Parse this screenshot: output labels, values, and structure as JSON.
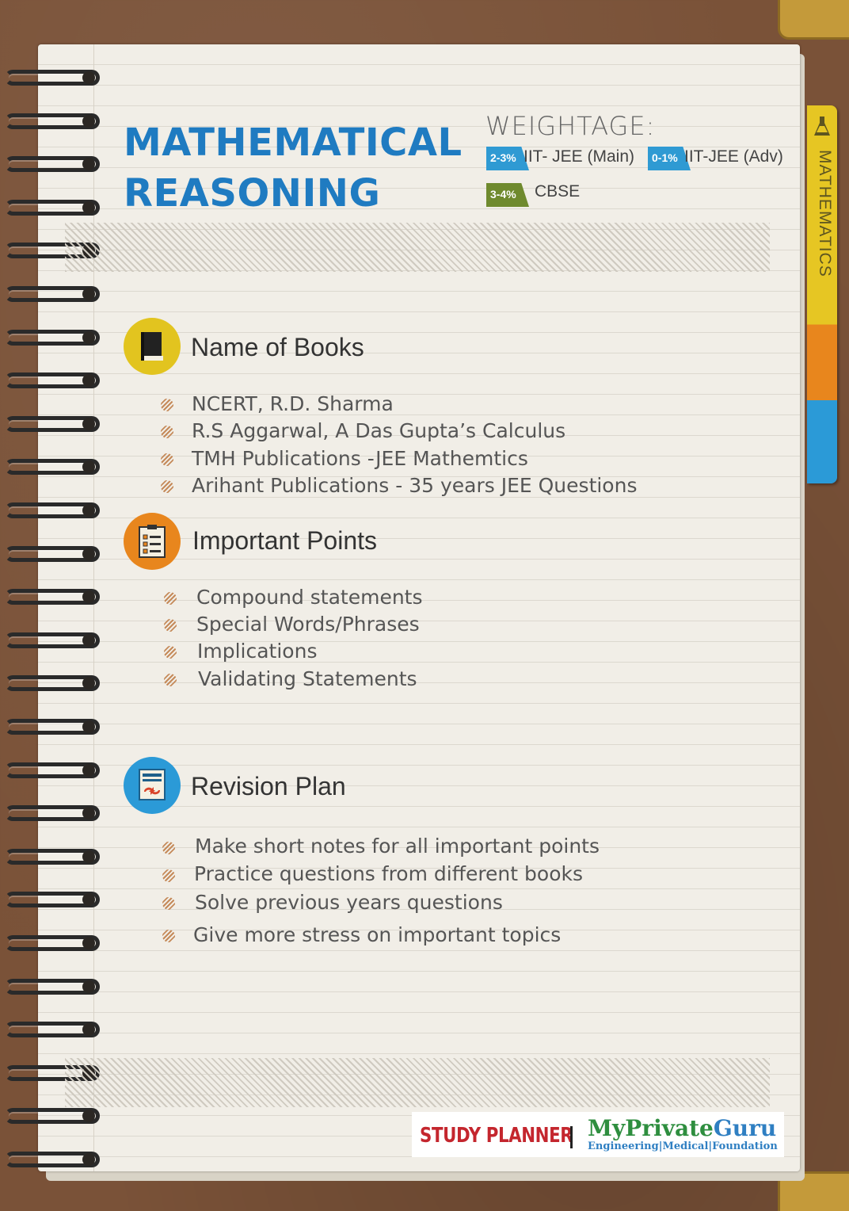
{
  "header": {
    "title_line1": "MATHEMATICAL",
    "title_line2": "REASONING"
  },
  "weightage": {
    "title": "WEIGHTAGE:",
    "items": [
      {
        "badge": "2-3%",
        "label": "IIT- JEE (Main)",
        "color": "#2f9ad3"
      },
      {
        "badge": "0-1%",
        "label": "IIT-JEE (Adv)",
        "color": "#2f9ad3"
      },
      {
        "badge": "3-4%",
        "label": "CBSE",
        "color": "#6f8a2e"
      }
    ]
  },
  "side_tab": {
    "label": "MATHEMATICS",
    "colors": [
      "#e6c623",
      "#e8861d",
      "#2b9ad7"
    ]
  },
  "sections": [
    {
      "title": "Name of Books",
      "icon": "book-icon",
      "icon_color": "#e2c41f",
      "items": [
        "NCERT, R.D. Sharma",
        "R.S Aggarwal, A Das Gupta’s Calculus",
        "TMH  Publications  -JEE Mathemtics",
        "Arihant Publications - 35 years JEE Questions"
      ]
    },
    {
      "title": "Important Points",
      "icon": "checklist-icon",
      "icon_color": "#e8861d",
      "items": [
        "Compound statements",
        "Special Words/Phrases",
        "Implications",
        "Validating Statements"
      ]
    },
    {
      "title": "Revision Plan",
      "icon": "revision-icon",
      "icon_color": "#2b9ad7",
      "items": [
        "Make short notes for all important points",
        "Practice questions from different books",
        "Solve previous years questions",
        "Give more stress on important topics"
      ]
    }
  ],
  "footer": {
    "study_planner": "STUDY PLANNER",
    "brand_my": "MyPrivate",
    "brand_guru": "Guru",
    "tagline": "Engineering|Medical|Foundation"
  }
}
